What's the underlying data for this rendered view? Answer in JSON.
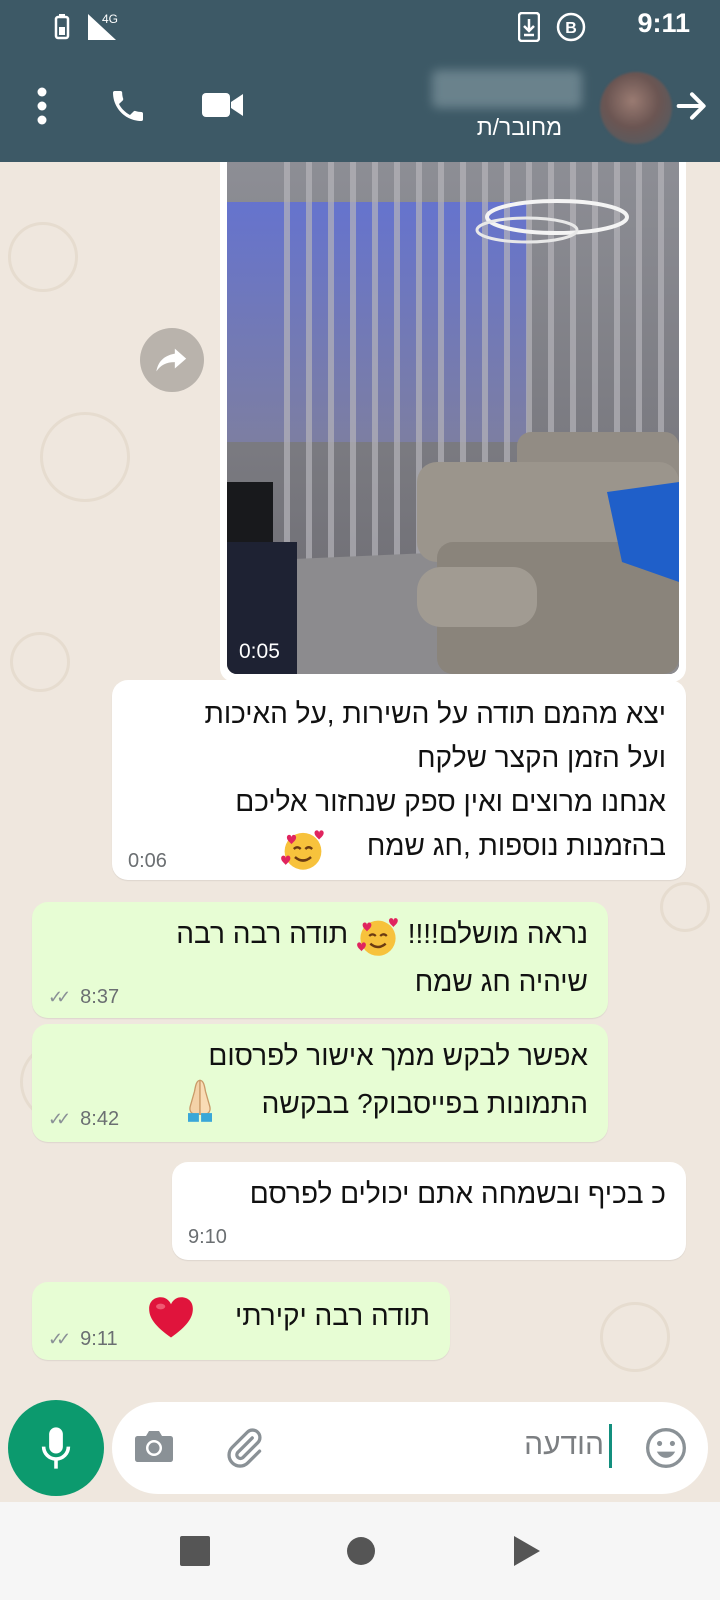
{
  "status_bar": {
    "time": "9:11",
    "network": "4G",
    "icons": [
      "battery-icon",
      "signal-icon",
      "download-icon",
      "b-badge-icon"
    ]
  },
  "header": {
    "contact_status": "מחובר/ת",
    "icons": [
      "more-vert-icon",
      "call-icon",
      "video-call-icon",
      "avatar",
      "forward-arrow-icon"
    ]
  },
  "messages": [
    {
      "type": "video",
      "direction": "incoming",
      "duration": "0:05"
    },
    {
      "direction": "incoming",
      "lines": [
        "יצא מהמם תודה על השירות ,על האיכות",
        "ועל הזמן הקצר שלקח",
        "אנחנו מרוצים ואין ספק שנחזור אליכם",
        "בהזמנות נוספות ,חג שמח"
      ],
      "emoji": "smiling-face-with-hearts",
      "time": "0:06"
    },
    {
      "direction": "outgoing",
      "lines": [
        "תודה רבה רבה",
        "נראה מושלם!!!!",
        "שיהיה חג שמח"
      ],
      "emoji": "smiling-face-with-hearts",
      "time": "8:37",
      "read": true
    },
    {
      "direction": "outgoing",
      "lines": [
        "אפשר לבקש ממך אישור לפרסום",
        "התמונות בפייסבוק? בבקשה"
      ],
      "emoji": "folded-hands",
      "time": "8:42",
      "read": true
    },
    {
      "direction": "incoming",
      "lines": [
        "כ בכיף ובשמחה אתם יכולים לפרסם"
      ],
      "time": "9:10"
    },
    {
      "direction": "outgoing",
      "lines": [
        "תודה רבה יקירתי"
      ],
      "emoji": "red-heart",
      "time": "9:11",
      "read": true
    }
  ],
  "composer": {
    "placeholder": "הודעה",
    "icons": [
      "emoji-icon",
      "attach-icon",
      "camera-icon",
      "mic-icon"
    ]
  },
  "nav": {
    "icons": [
      "recent-apps-icon",
      "home-icon",
      "back-icon"
    ]
  },
  "colors": {
    "header": "#3d5966",
    "chat_bg": "#efe7de",
    "outgoing_bubble": "#e7fdd4",
    "incoming_bubble": "#ffffff",
    "accent": "#0c9a6e"
  }
}
